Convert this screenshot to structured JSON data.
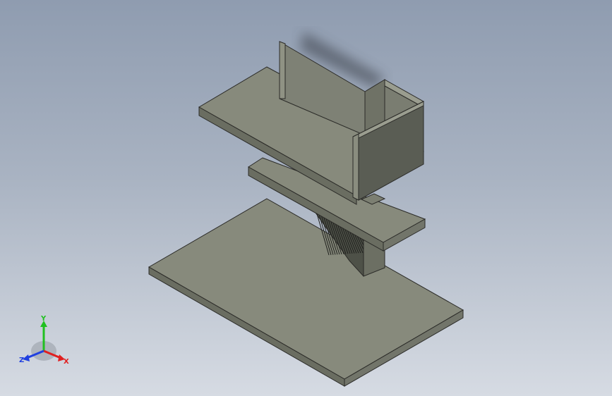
{
  "viewport": {
    "background_top": "#8f9cb0",
    "background_bottom": "#d6dbe3"
  },
  "model": {
    "face_color_light": "#878a7c",
    "face_color_dark": "#5a5d54",
    "face_color_mid": "#6f7266",
    "edge_color": "#2b2b28"
  },
  "triad": {
    "x_label": "X",
    "y_label": "Y",
    "z_label": "Z",
    "x_color": "#e02020",
    "y_color": "#20c020",
    "z_color": "#2040e0"
  }
}
